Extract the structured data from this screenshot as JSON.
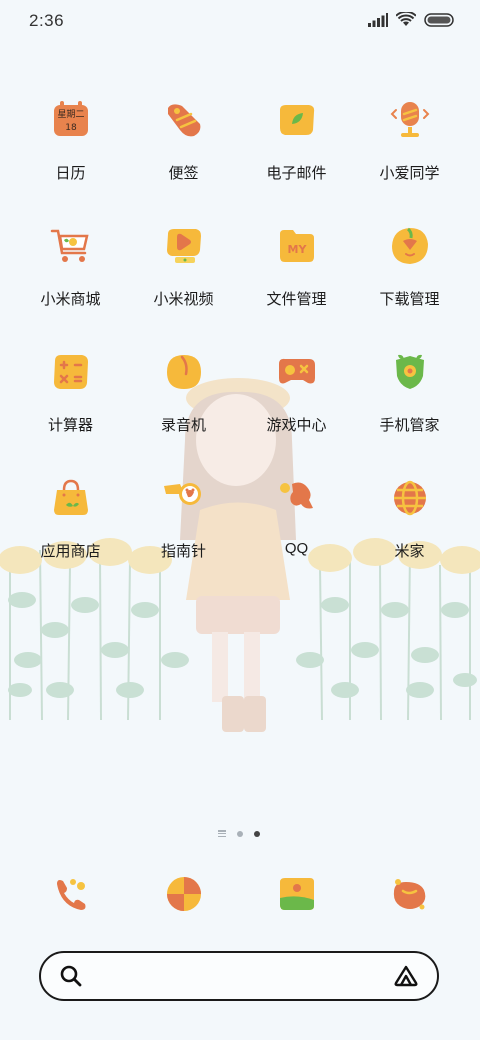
{
  "status_bar": {
    "time": "2:36",
    "icons": [
      "signal-icon",
      "wifi-icon",
      "battery-icon"
    ]
  },
  "apps": [
    {
      "name": "calendar",
      "label": "日历",
      "icon": "calendar-icon",
      "badge_text": "星期二",
      "badge_day": "18"
    },
    {
      "name": "notes",
      "label": "便签",
      "icon": "notes-icon"
    },
    {
      "name": "email",
      "label": "电子邮件",
      "icon": "email-icon"
    },
    {
      "name": "xiaoai",
      "label": "小爱同学",
      "icon": "microphone-icon"
    },
    {
      "name": "mi-store",
      "label": "小米商城",
      "icon": "shopping-cart-icon"
    },
    {
      "name": "mi-video",
      "label": "小米视频",
      "icon": "video-icon"
    },
    {
      "name": "file-manager",
      "label": "文件管理",
      "icon": "folder-icon",
      "folder_text": "MY"
    },
    {
      "name": "downloads",
      "label": "下载管理",
      "icon": "download-icon"
    },
    {
      "name": "calculator",
      "label": "计算器",
      "icon": "calculator-icon"
    },
    {
      "name": "recorder",
      "label": "录音机",
      "icon": "recorder-icon"
    },
    {
      "name": "game-center",
      "label": "游戏中心",
      "icon": "gamepad-icon"
    },
    {
      "name": "security",
      "label": "手机管家",
      "icon": "shield-icon"
    },
    {
      "name": "app-store",
      "label": "应用商店",
      "icon": "shopping-bag-icon"
    },
    {
      "name": "compass",
      "label": "指南针",
      "icon": "compass-icon"
    },
    {
      "name": "qq",
      "label": "QQ",
      "icon": "qq-icon"
    },
    {
      "name": "mi-home",
      "label": "米家",
      "icon": "globe-icon"
    }
  ],
  "page_indicator": {
    "pages": 2,
    "active_page": 2
  },
  "dock": [
    {
      "name": "phone",
      "icon": "phone-icon"
    },
    {
      "name": "browser",
      "icon": "browser-icon"
    },
    {
      "name": "messages",
      "icon": "messages-icon"
    },
    {
      "name": "camera",
      "icon": "camera-icon"
    }
  ],
  "search": {
    "placeholder": ""
  },
  "colors": {
    "background": "#f3f8fb",
    "icon_yellow": "#f6b93b",
    "icon_orange": "#e7814f",
    "icon_green": "#6bb84a"
  }
}
